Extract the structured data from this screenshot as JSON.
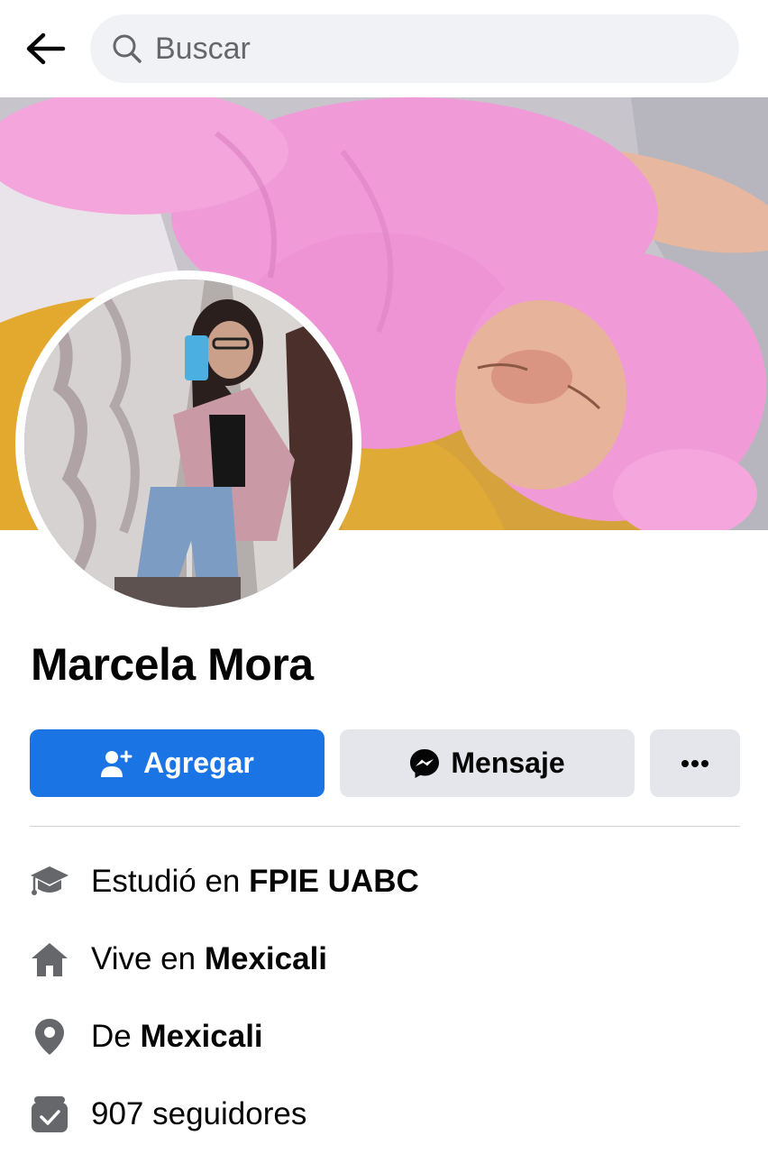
{
  "header": {
    "search_placeholder": "Buscar"
  },
  "profile": {
    "name": "Marcela Mora"
  },
  "actions": {
    "add_label": "Agregar",
    "message_label": "Mensaje"
  },
  "intro": {
    "education": {
      "prefix": "Estudió en ",
      "value": "FPIE UABC",
      "icon": "graduation-cap-icon"
    },
    "lives_in": {
      "prefix": "Vive en ",
      "value": "Mexicali",
      "icon": "home-icon"
    },
    "from": {
      "prefix": "De ",
      "value": "Mexicali",
      "icon": "location-pin-icon"
    },
    "followers": {
      "text": "907 seguidores",
      "icon": "followers-icon"
    }
  },
  "colors": {
    "primary_button": "#1b74e4",
    "secondary_button": "#e4e6eb",
    "search_bg": "#f0f2f5",
    "icon_gray": "#65676b"
  }
}
